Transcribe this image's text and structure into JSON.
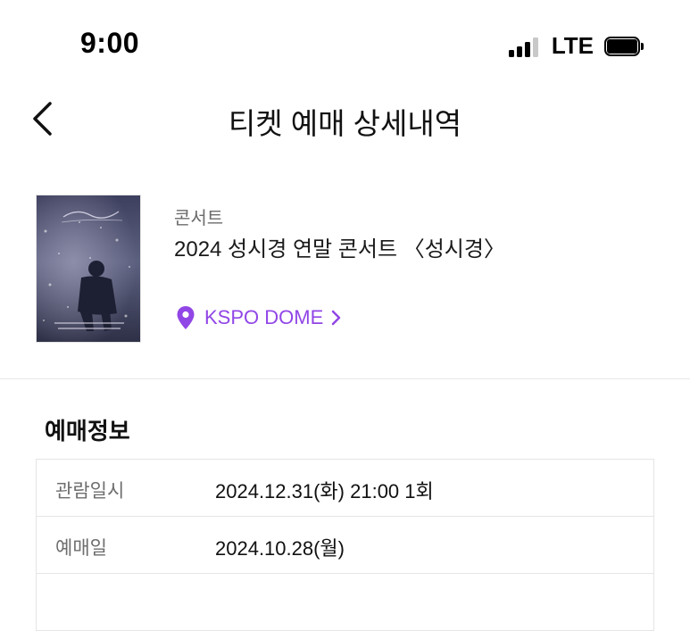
{
  "status_bar": {
    "time": "9:00",
    "network": "LTE",
    "signal_icon": "signal-bars-icon",
    "battery_icon": "battery-icon"
  },
  "header": {
    "back_icon": "chevron-left-icon",
    "title": "티켓 예매 상세내역"
  },
  "event": {
    "poster_icon": "concert-poster-image",
    "category": "콘서트",
    "title": "2024 성시경 연말 콘서트 〈성시경〉",
    "venue": "KSPO DOME",
    "venue_icon": "location-pin-icon",
    "accent_color": "#9146e6"
  },
  "booking_info": {
    "section_title": "예매정보",
    "rows": [
      {
        "label": "관람일시",
        "value": "2024.12.31(화) 21:00 1회"
      },
      {
        "label": "예매일",
        "value": "2024.10.28(월)"
      },
      {
        "label": "",
        "value": ""
      }
    ]
  }
}
